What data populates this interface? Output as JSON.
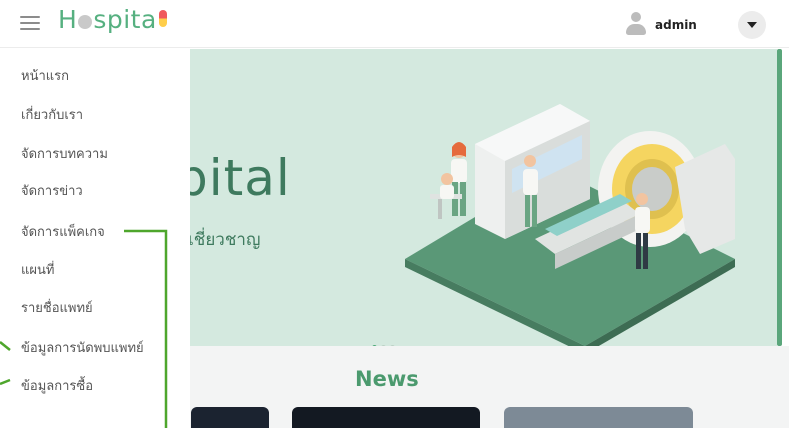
{
  "header": {
    "logo_prefix": "H",
    "logo_suffix": "spita",
    "username": "admin"
  },
  "sidebar": {
    "items": [
      {
        "label": "หน้าแรก"
      },
      {
        "label": "เกี่ยวกับเรา"
      },
      {
        "label": "จัดการบทความ"
      },
      {
        "label": "จัดการข่าว"
      },
      {
        "label": "จัดการแพ็คเกจ"
      },
      {
        "label": "แผนที่"
      },
      {
        "label": "รายชื่อแพทย์"
      },
      {
        "label": "ข้อมูลการนัดพบแพทย์"
      },
      {
        "label": "ข้อมูลการซื้อ"
      }
    ]
  },
  "banner": {
    "title": "pital",
    "subtitle": "เชี่ยวชาญ",
    "slides": 3,
    "active_slide": 1
  },
  "news": {
    "heading": "News"
  },
  "colors": {
    "brand_green": "#56b080",
    "banner_bg": "#d4e9df",
    "accent": "#4ea878"
  }
}
